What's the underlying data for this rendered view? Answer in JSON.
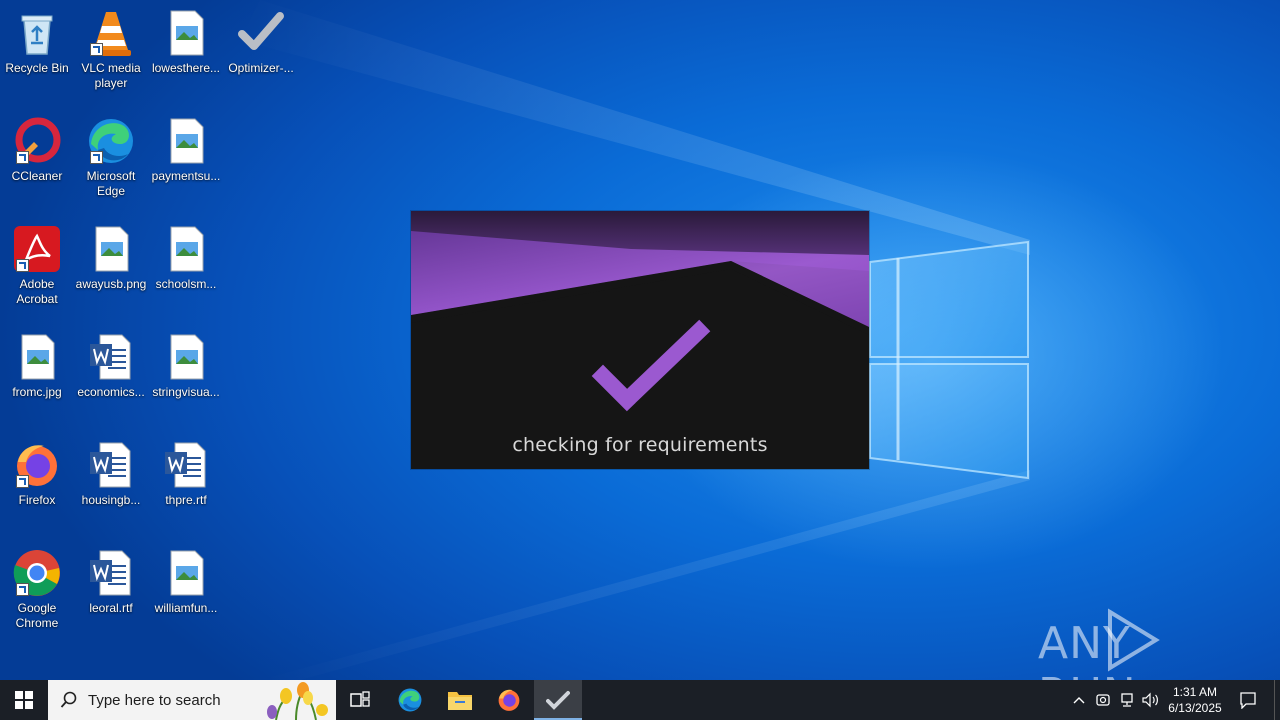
{
  "desktop": {
    "icons": [
      {
        "label": "Recycle Bin",
        "icon": "recycle-bin-icon"
      },
      {
        "label": "VLC media player",
        "icon": "vlc-icon"
      },
      {
        "label": "lowesthere...",
        "icon": "image-file-icon"
      },
      {
        "label": "Optimizer-...",
        "icon": "checkmark-icon"
      },
      {
        "label": "CCleaner",
        "icon": "ccleaner-icon"
      },
      {
        "label": "Microsoft Edge",
        "icon": "edge-icon"
      },
      {
        "label": "paymentsu...",
        "icon": "image-file-icon"
      },
      {
        "label": "Adobe Acrobat",
        "icon": "acrobat-icon"
      },
      {
        "label": "awayusb.png",
        "icon": "image-file-icon"
      },
      {
        "label": "schoolsm...",
        "icon": "image-file-icon"
      },
      {
        "label": "fromc.jpg",
        "icon": "image-file-icon"
      },
      {
        "label": "economics...",
        "icon": "word-doc-icon"
      },
      {
        "label": "stringvisua...",
        "icon": "image-file-icon"
      },
      {
        "label": "Firefox",
        "icon": "firefox-icon"
      },
      {
        "label": "housingb...",
        "icon": "word-doc-icon"
      },
      {
        "label": "thpre.rtf",
        "icon": "word-doc-icon"
      },
      {
        "label": "Google Chrome",
        "icon": "chrome-icon"
      },
      {
        "label": "leoral.rtf",
        "icon": "word-doc-icon"
      },
      {
        "label": "williamfun...",
        "icon": "image-file-icon"
      }
    ]
  },
  "splash": {
    "status": "checking for requirements",
    "accent_color": "#9b59d0"
  },
  "watermark": {
    "text": "ANY RUN"
  },
  "taskbar": {
    "search_placeholder": "Type here to search",
    "pinned": [
      "Microsoft Edge",
      "File Explorer",
      "Firefox",
      "Optimizer"
    ],
    "clock_time": "1:31 AM",
    "clock_date": "6/13/2025"
  },
  "colors": {
    "desktop_blue": "#0a6bd6",
    "taskbar": "#1b1f26"
  }
}
